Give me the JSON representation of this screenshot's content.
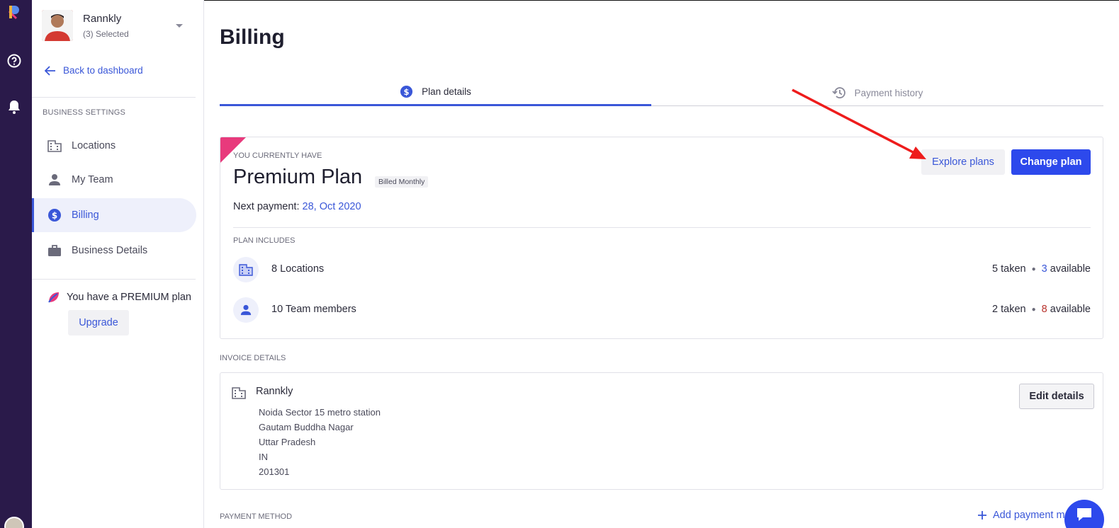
{
  "user": {
    "name": "Rannkly",
    "selected": "(3) Selected"
  },
  "sidebar": {
    "back_label": "Back to dashboard",
    "section_label": "BUSINESS SETTINGS",
    "items": [
      {
        "label": "Locations",
        "icon": "building-icon"
      },
      {
        "label": "My Team",
        "icon": "person-icon"
      },
      {
        "label": "Billing",
        "icon": "dollar-icon"
      },
      {
        "label": "Business Details",
        "icon": "briefcase-icon"
      }
    ],
    "premium_text": "You have a PREMIUM plan",
    "upgrade_label": "Upgrade"
  },
  "page": {
    "title": "Billing"
  },
  "tabs": [
    {
      "label": "Plan details",
      "active": true
    },
    {
      "label": "Payment history",
      "active": false
    }
  ],
  "plan": {
    "current_label": "YOU CURRENTLY HAVE",
    "name": "Premium Plan",
    "billing": "Billed Monthly",
    "next_payment_label": "Next payment:",
    "next_payment_date": "28, Oct 2020",
    "explore_label": "Explore plans",
    "change_label": "Change plan",
    "includes_label": "PLAN INCLUDES",
    "includes": [
      {
        "label": "8 Locations",
        "taken": "5 taken",
        "available_num": "3",
        "available_text": "available"
      },
      {
        "label": "10 Team members",
        "taken": "2 taken",
        "available_num": "8",
        "available_text": "available"
      }
    ]
  },
  "invoice": {
    "label": "INVOICE DETAILS",
    "name": "Rannkly",
    "address": [
      "Noida Sector 15 metro station",
      "Gautam Buddha Nagar",
      "Uttar Pradesh",
      "IN",
      "201301"
    ],
    "edit_label": "Edit details"
  },
  "payment": {
    "label": "PAYMENT METHOD",
    "add_label": "Add payment m"
  },
  "colors": {
    "accent": "#3a57d8",
    "primary_button": "#2d49ec",
    "rail": "#2a1a4a",
    "corner": "#e83a7c",
    "annotation_arrow": "#ee1c1c"
  }
}
